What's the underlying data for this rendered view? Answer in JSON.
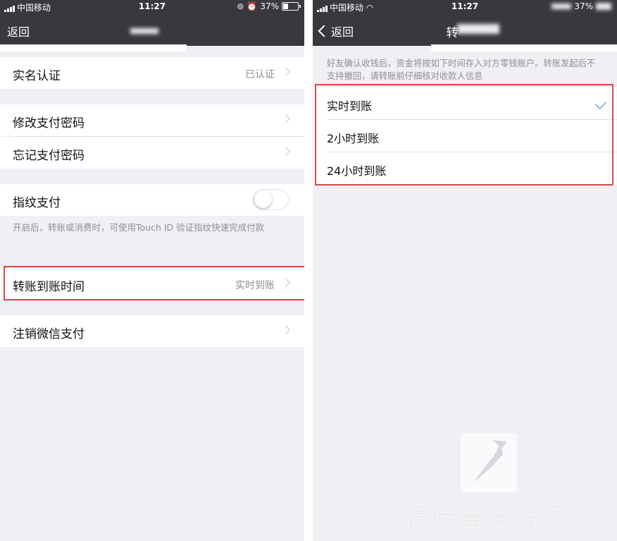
{
  "left": {
    "status": {
      "carrier": "中国移动",
      "time": "11:27",
      "battery": "37%",
      "battery_level": 0.37
    },
    "nav": {
      "back": "返回"
    },
    "cells": {
      "real_name": {
        "label": "实名认证",
        "value": "已认证"
      },
      "change_pwd": {
        "label": "修改支付密码"
      },
      "forgot_pwd": {
        "label": "忘记支付密码"
      },
      "fingerprint": {
        "label": "指纹支付",
        "enabled": false
      },
      "fingerprint_note": "开启后，转账或消费时，可使用Touch ID 验证指纹快速完成付款",
      "transfer_time": {
        "label": "转账到账时间",
        "value": "实时到账"
      },
      "cancel_pay": {
        "label": "注销微信支付"
      }
    }
  },
  "right": {
    "status": {
      "carrier": "中国移动",
      "time": "11:27",
      "battery": "37%",
      "battery_level": 0.37
    },
    "nav": {
      "back": "返回",
      "title": "转"
    },
    "note": "好友确认收钱后，资金将按如下时间存入对方零钱账户。转账发起后不支持撤回，请转账前仔细核对收款人信息",
    "options": [
      {
        "label": "实时到账",
        "selected": true
      },
      {
        "label": "2小时到账",
        "selected": false
      },
      {
        "label": "24小时到账",
        "selected": false
      }
    ]
  },
  "watermark": {
    "text": "高质量生活家"
  },
  "colors": {
    "highlight": "#d94848",
    "navbar": "#38383d",
    "background": "#efeff4"
  }
}
